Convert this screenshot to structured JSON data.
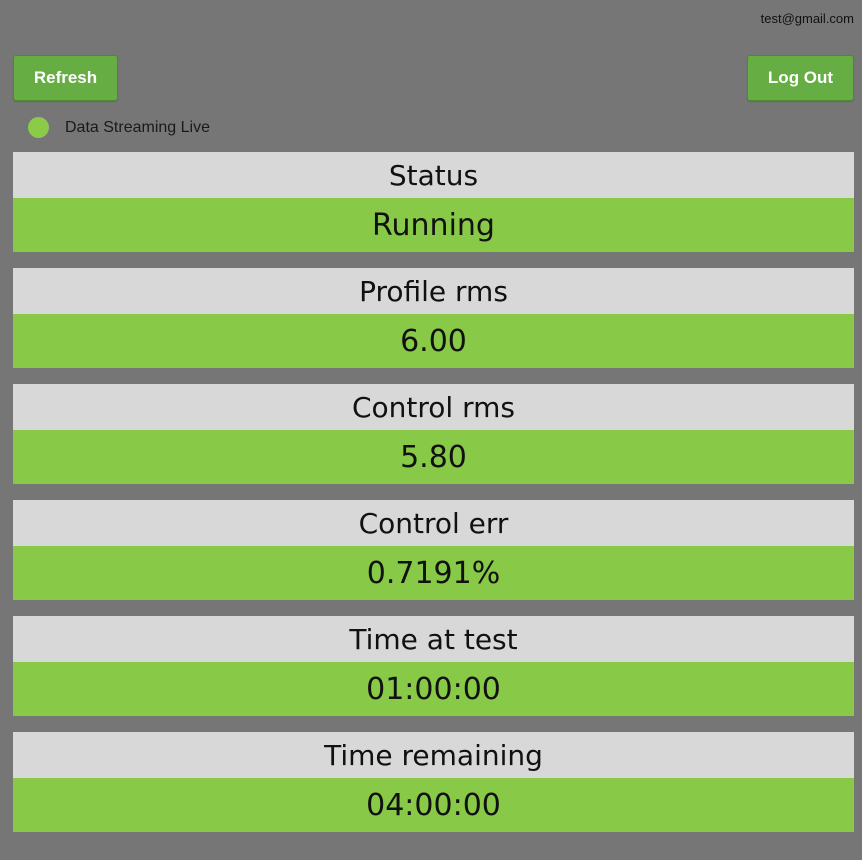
{
  "header": {
    "user_email": "test@gmail.com",
    "refresh_label": "Refresh",
    "logout_label": "Log Out"
  },
  "live": {
    "label": "Data Streaming Live",
    "color": "#8ccb48"
  },
  "colors": {
    "background": "#767676",
    "title_bg": "#d8d8d8",
    "value_bg": "#88c947",
    "button_bg": "#66ad43"
  },
  "metrics": [
    {
      "title": "Status",
      "value": "Running"
    },
    {
      "title": "Profile rms",
      "value": "6.00"
    },
    {
      "title": "Control rms",
      "value": "5.80"
    },
    {
      "title": "Control err",
      "value": "0.7191%"
    },
    {
      "title": "Time at test",
      "value": "01:00:00"
    },
    {
      "title": "Time remaining",
      "value": "04:00:00"
    }
  ]
}
